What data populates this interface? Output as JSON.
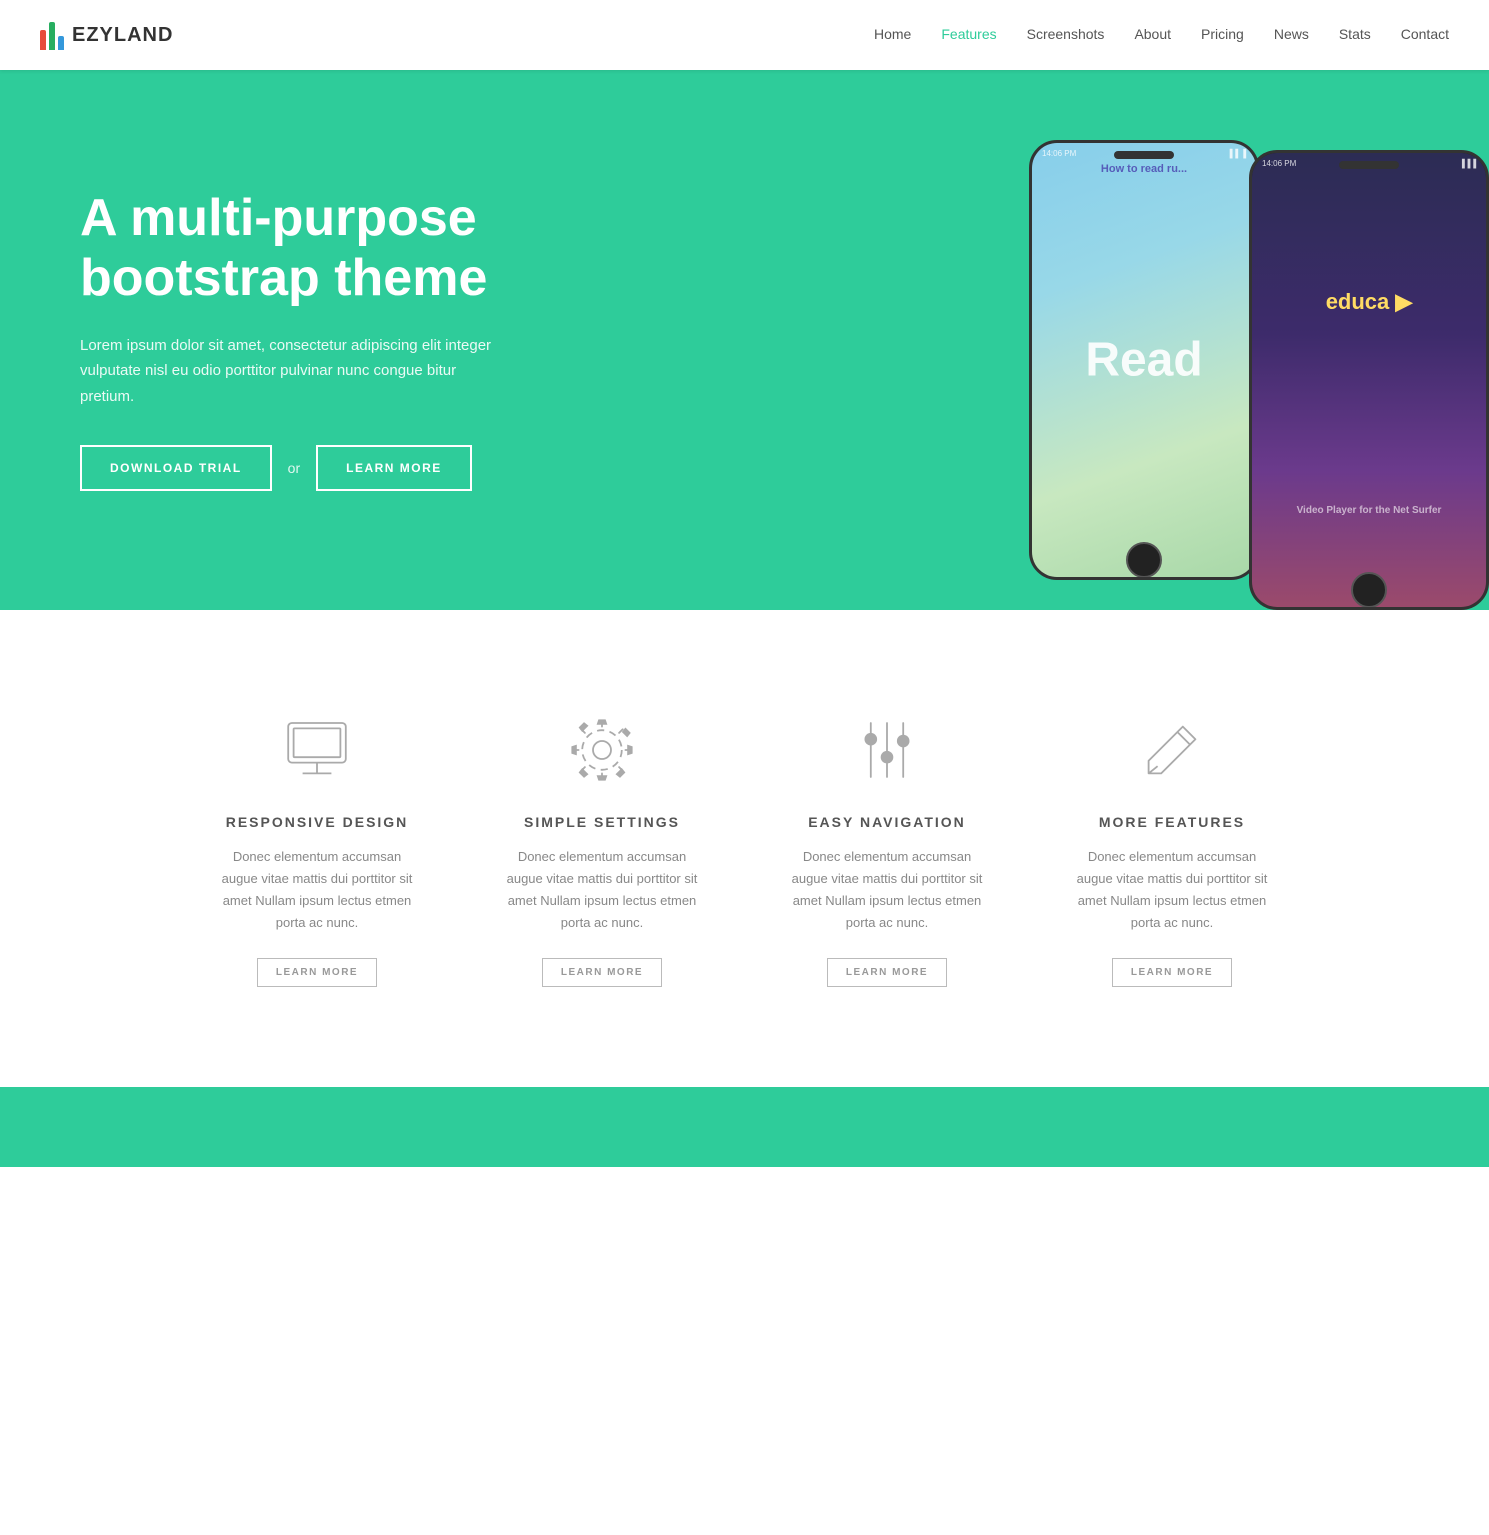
{
  "navbar": {
    "logo_text": "EZYLAND",
    "links": [
      {
        "label": "Home",
        "active": false
      },
      {
        "label": "Features",
        "active": true
      },
      {
        "label": "Screenshots",
        "active": false
      },
      {
        "label": "About",
        "active": false
      },
      {
        "label": "Pricing",
        "active": false
      },
      {
        "label": "News",
        "active": false
      },
      {
        "label": "Stats",
        "active": false
      },
      {
        "label": "Contact",
        "active": false
      }
    ]
  },
  "hero": {
    "title": "A multi-purpose bootstrap theme",
    "description": "Lorem ipsum dolor sit amet, consectetur adipiscing elit integer vulputate nisl eu odio porttitor pulvinar nunc congue bitur pretium.",
    "btn_download": "DOWNLOAD TRIAL",
    "btn_or": "or",
    "btn_learn": "LEARN MORE",
    "phone_time": "14:06 PM"
  },
  "features": {
    "items": [
      {
        "id": "responsive",
        "title": "RESPONSIVE DESIGN",
        "description": "Donec elementum accumsan augue vitae mattis dui porttitor sit amet Nullam ipsum lectus etmen porta ac nunc.",
        "learn_more": "LEARN MORE",
        "icon": "monitor"
      },
      {
        "id": "settings",
        "title": "SIMPLE SETTINGS",
        "description": "Donec elementum accumsan augue vitae mattis dui porttitor sit amet Nullam ipsum lectus etmen porta ac nunc.",
        "learn_more": "LEARN MORE",
        "icon": "gear"
      },
      {
        "id": "navigation",
        "title": "EASY NAVIGATION",
        "description": "Donec elementum accumsan augue vitae mattis dui porttitor sit amet Nullam ipsum lectus etmen porta ac nunc.",
        "learn_more": "LEARN MORE",
        "icon": "sliders"
      },
      {
        "id": "more",
        "title": "MORE FEATURES",
        "description": "Donec elementum accumsan augue vitae mattis dui porttitor sit amet Nullam ipsum lectus etmen porta ac nunc.",
        "learn_more": "LEARN MORE",
        "icon": "pencil"
      }
    ]
  },
  "colors": {
    "brand_green": "#2ecc9a",
    "dark": "#333",
    "gray": "#888",
    "red": "#e74c3c",
    "blue": "#3498db",
    "green_bar": "#27ae60"
  }
}
